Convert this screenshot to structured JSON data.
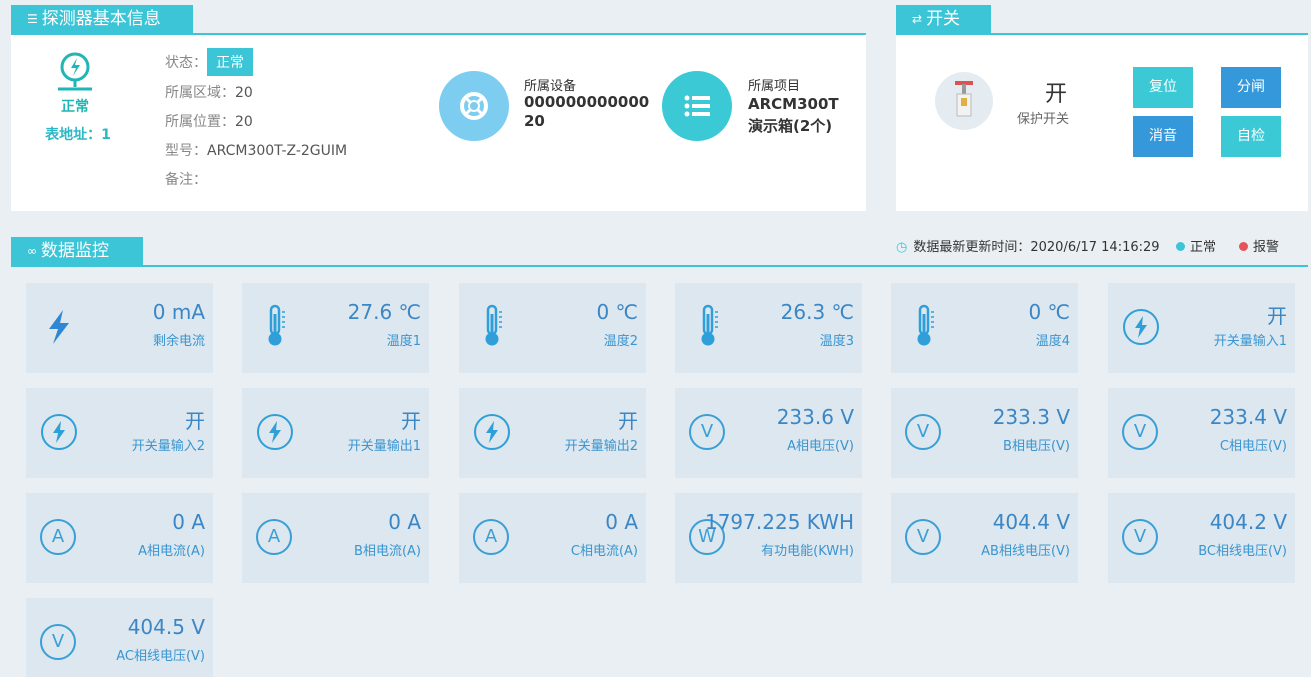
{
  "info": {
    "tab_title": "探测器基本信息",
    "meter_status": "正常",
    "meter_address": "表地址：1",
    "status_label": "状态：",
    "status_value": "正常",
    "area_label": "所属区域：",
    "area_value": "20",
    "position_label": "所属位置：",
    "position_value": "20",
    "model_label": "型号：",
    "model_value": "ARCM300T-Z-2GUIM",
    "remark_label": "备注：",
    "device_title": "所属设备",
    "device_value_line1": "000000000000",
    "device_value_line2": "20",
    "project_title": "所属项目",
    "project_value_line1": "ARCM300T",
    "project_value_line2": "演示箱(2个)"
  },
  "switch": {
    "tab_title": "开关",
    "state": "开",
    "label": "保护开关",
    "buttons": {
      "reset": "复位",
      "open": "分闸",
      "mute": "消音",
      "selftest": "自检"
    }
  },
  "monitor": {
    "tab_title": "数据监控",
    "update_label": "数据最新更新时间：",
    "update_time": "2020/6/17 14:16:29",
    "legend_normal": "正常",
    "legend_alarm": "报警",
    "tiles": [
      {
        "value": "0 mA",
        "name": "剩余电流",
        "icon": "lightning-icon"
      },
      {
        "value": "27.6 ℃",
        "name": "温度1",
        "icon": "thermometer-icon"
      },
      {
        "value": "0 ℃",
        "name": "温度2",
        "icon": "thermometer-icon"
      },
      {
        "value": "26.3 ℃",
        "name": "温度3",
        "icon": "thermometer-icon"
      },
      {
        "value": "0 ℃",
        "name": "温度4",
        "icon": "thermometer-icon"
      },
      {
        "value": "开",
        "name": "开关量输入1",
        "icon": "switch-bolt-icon"
      },
      {
        "value": "开",
        "name": "开关量输入2",
        "icon": "switch-bolt-icon"
      },
      {
        "value": "开",
        "name": "开关量输出1",
        "icon": "switch-bolt-icon"
      },
      {
        "value": "开",
        "name": "开关量输出2",
        "icon": "switch-bolt-icon"
      },
      {
        "value": "233.6 V",
        "name": "A相电压(V)",
        "icon": "voltage-icon",
        "glyph": "V"
      },
      {
        "value": "233.3 V",
        "name": "B相电压(V)",
        "icon": "voltage-icon",
        "glyph": "V"
      },
      {
        "value": "233.4 V",
        "name": "C相电压(V)",
        "icon": "voltage-icon",
        "glyph": "V"
      },
      {
        "value": "0 A",
        "name": "A相电流(A)",
        "icon": "current-icon",
        "glyph": "A"
      },
      {
        "value": "0 A",
        "name": "B相电流(A)",
        "icon": "current-icon",
        "glyph": "A"
      },
      {
        "value": "0 A",
        "name": "C相电流(A)",
        "icon": "current-icon",
        "glyph": "A"
      },
      {
        "value": "1797.225 KWH",
        "name": "有功电能(KWH)",
        "icon": "energy-icon",
        "glyph": "W"
      },
      {
        "value": "404.4 V",
        "name": "AB相线电压(V)",
        "icon": "voltage-icon",
        "glyph": "V"
      },
      {
        "value": "404.2 V",
        "name": "BC相线电压(V)",
        "icon": "voltage-icon",
        "glyph": "V"
      },
      {
        "value": "404.5 V",
        "name": "AC相线电压(V)",
        "icon": "voltage-icon",
        "glyph": "V"
      }
    ]
  },
  "colors": {
    "accent": "#3cc5d6",
    "blue_button": "#3498db",
    "value_text": "#3b86c5",
    "alarm": "#e8525a",
    "normal": "#3cc5d6"
  }
}
